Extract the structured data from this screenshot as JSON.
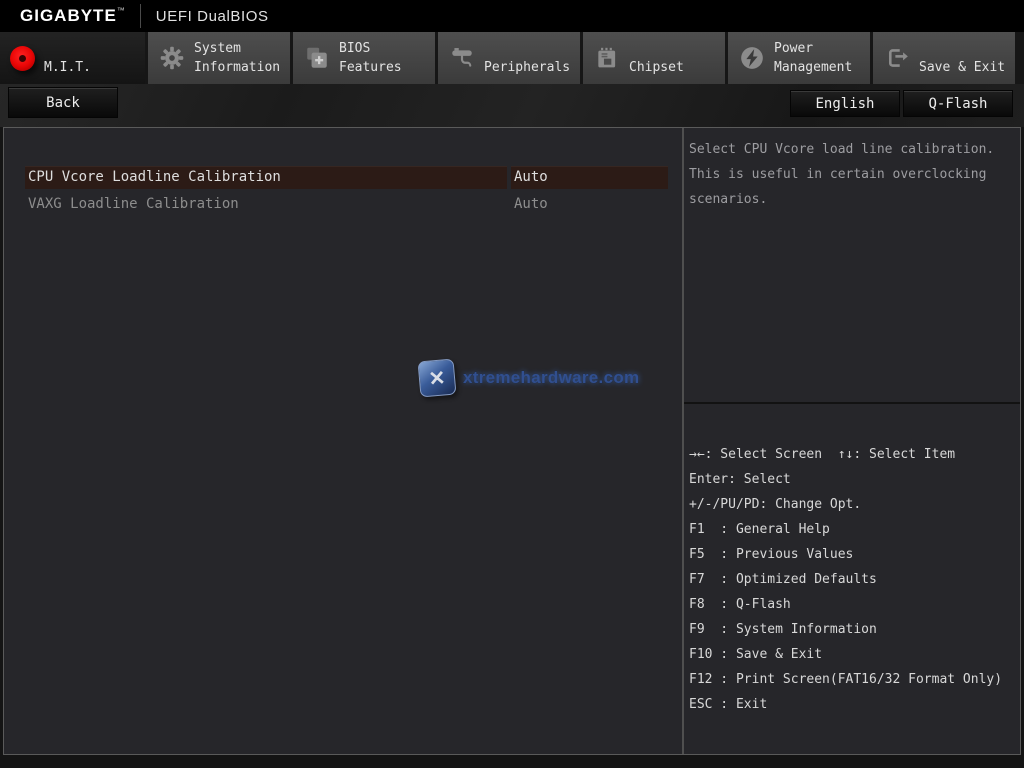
{
  "titlebar": {
    "brand": "GIGABYTE",
    "trademark": "™",
    "product": "UEFI DualBIOS"
  },
  "tabs": [
    {
      "label": "M.I.T.",
      "active": true
    },
    {
      "label": "System\nInformation",
      "active": false
    },
    {
      "label": "BIOS\nFeatures",
      "active": false
    },
    {
      "label": "Peripherals",
      "active": false
    },
    {
      "label": "Chipset",
      "active": false
    },
    {
      "label": "Power\nManagement",
      "active": false
    },
    {
      "label": "Save & Exit",
      "active": false
    }
  ],
  "toolbar": {
    "back_label": "Back",
    "language_label": "English",
    "qflash_label": "Q-Flash"
  },
  "settings": {
    "rows": [
      {
        "label": "CPU Vcore Loadline Calibration",
        "value": "Auto",
        "state": "selected"
      },
      {
        "label": "VAXG Loadline Calibration",
        "value": "Auto",
        "state": "disabled"
      }
    ]
  },
  "help_panel": {
    "lines": [
      "Select CPU Vcore load line calibration.",
      "This is useful in certain overclocking",
      "scenarios."
    ]
  },
  "key_legend": {
    "lines": [
      "→←: Select Screen  ↑↓: Select Item",
      "Enter: Select",
      "+/-/PU/PD: Change Opt.",
      "F1  : General Help",
      "F5  : Previous Values",
      "F7  : Optimized Defaults",
      "F8  : Q-Flash",
      "F9  : System Information",
      "F10 : Save & Exit",
      "F12 : Print Screen(FAT16/32 Format Only)",
      "ESC : Exit"
    ]
  },
  "watermark": {
    "icon_glyph": "✕",
    "text": "xtremehardware.com"
  },
  "colors": {
    "accent_red": "#e60000",
    "selected_row_bg": "#2c1b16",
    "panel_bg": "#26262a",
    "tab_bg": "#454545",
    "tab_active_bg": "#1d1d1d",
    "watermark_blue": "#33549a"
  }
}
